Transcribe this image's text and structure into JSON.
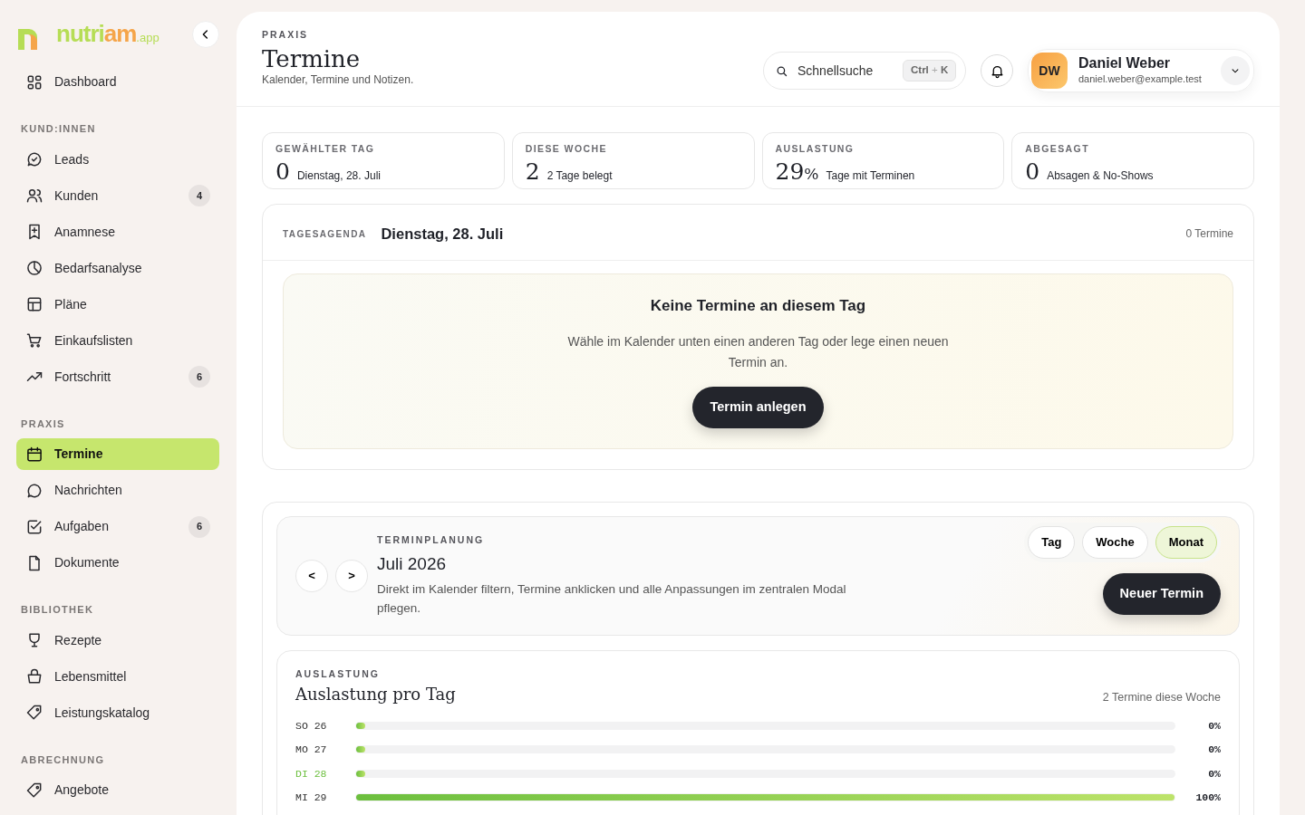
{
  "logo": {
    "first": "nutri",
    "second": "am",
    "suffix": ".app"
  },
  "sidebar": {
    "groups": [
      {
        "items": [
          {
            "label": "Dashboard",
            "selected": false
          }
        ]
      },
      {
        "heading": "KUND:INNEN",
        "items": [
          {
            "label": "Leads",
            "selected": false
          },
          {
            "label": "Kunden",
            "selected": false,
            "badge": "4"
          },
          {
            "label": "Anamnese",
            "selected": false
          },
          {
            "label": "Bedarfsanalyse",
            "selected": false
          },
          {
            "label": "Pläne",
            "selected": false
          },
          {
            "label": "Einkaufslisten",
            "selected": false
          },
          {
            "label": "Fortschritt",
            "selected": false,
            "badge": "6"
          }
        ]
      },
      {
        "heading": "PRAXIS",
        "items": [
          {
            "label": "Termine",
            "selected": true
          },
          {
            "label": "Nachrichten",
            "selected": false
          },
          {
            "label": "Aufgaben",
            "selected": false,
            "badge": "6"
          },
          {
            "label": "Dokumente",
            "selected": false
          }
        ]
      },
      {
        "heading": "BIBLIOTHEK",
        "items": [
          {
            "label": "Rezepte",
            "selected": false
          },
          {
            "label": "Lebensmittel",
            "selected": false
          },
          {
            "label": "Leistungskatalog",
            "selected": false
          }
        ]
      },
      {
        "heading": "ABRECHNUNG",
        "items": [
          {
            "label": "Angebote",
            "selected": false
          }
        ]
      }
    ]
  },
  "header": {
    "eyebrow": "PRAXIS",
    "title": "Termine",
    "subtitle": "Kalender, Termine und Notizen.",
    "search": {
      "placeholder": "Schnellsuche",
      "shortcut_a": "Ctrl",
      "shortcut_sep": "+",
      "shortcut_b": "K"
    },
    "user": {
      "initials": "DW",
      "name": "Daniel Weber",
      "email": "daniel.weber@example.test"
    }
  },
  "stats": [
    {
      "label": "GEWÄHLTER TAG",
      "value": "0",
      "note": "Dienstag, 28. Juli"
    },
    {
      "label": "DIESE WOCHE",
      "value": "2",
      "note": "2 Tage belegt"
    },
    {
      "label": "AUSLASTUNG",
      "value": "29",
      "unit": "%",
      "note": "Tage mit Terminen"
    },
    {
      "label": "ABGESAGT",
      "value": "0",
      "note": "Absagen & No-Shows"
    }
  ],
  "agenda": {
    "eyebrow": "TAGESAGENDA",
    "date": "Dienstag, 28. Juli",
    "count": "0 Termine",
    "empty_title": "Keine Termine an diesem Tag",
    "empty_text": "Wähle im Kalender unten einen anderen Tag oder lege einen neuen Termin an.",
    "button": "Termin anlegen"
  },
  "planning": {
    "prev": "<",
    "next": ">",
    "eyebrow": "TERMINPLANUNG",
    "title": "Juli 2026",
    "text": "Direkt im Kalender filtern, Termine anklicken und alle Anpassungen im zentralen Modal pflegen.",
    "views": [
      {
        "label": "Tag",
        "selected": false
      },
      {
        "label": "Woche",
        "selected": false
      },
      {
        "label": "Monat",
        "selected": true
      }
    ],
    "button": "Neuer Termin"
  },
  "occupancy": {
    "eyebrow": "AUSLASTUNG",
    "title": "Auslastung pro Tag",
    "summary": "2 Termine diese Woche",
    "days": [
      {
        "label": "SO 26",
        "level": 0,
        "reading": "0%",
        "selected": false
      },
      {
        "label": "MO 27",
        "level": 0,
        "reading": "0%",
        "selected": false
      },
      {
        "label": "DI 28",
        "level": 0,
        "reading": "0%",
        "selected": true
      },
      {
        "label": "MI 29",
        "level": 1,
        "reading": "100%",
        "selected": false
      }
    ]
  }
}
